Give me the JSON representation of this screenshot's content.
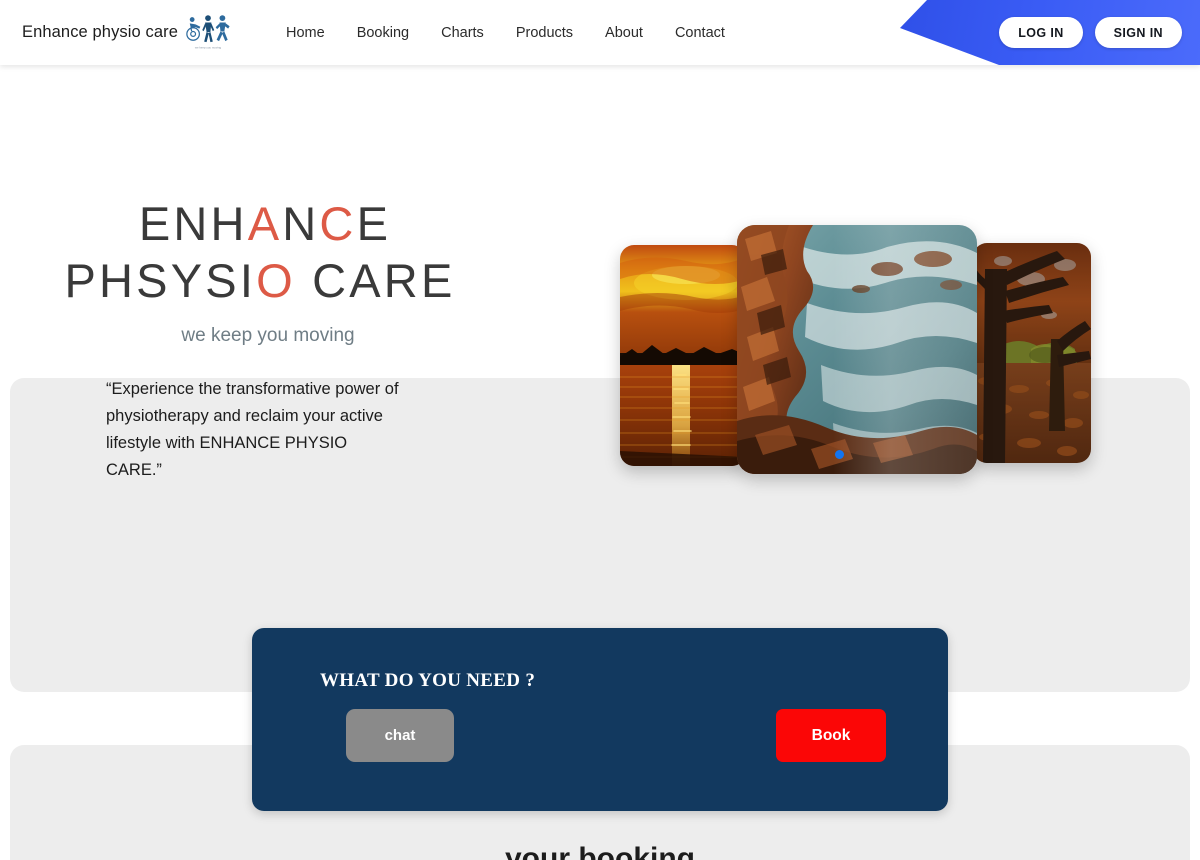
{
  "header": {
    "brand_text": "Enhance physio care",
    "logo_icon": "physio-figures-logo",
    "logo_tagline": "we keep you moving",
    "nav": [
      {
        "label": "Home"
      },
      {
        "label": "Booking"
      },
      {
        "label": "Charts"
      },
      {
        "label": "Products"
      },
      {
        "label": "About"
      },
      {
        "label": "Contact"
      }
    ],
    "login_label": "LOG IN",
    "signin_label": "SIGN IN",
    "banner_color": "#3a5cf5"
  },
  "hero": {
    "title_line1_a": "ENH",
    "title_line1_accent1": "A",
    "title_line1_b": "N",
    "title_line1_accent2": "C",
    "title_line1_c": "E",
    "title_line2_a": "PHSYSI",
    "title_line2_accent": "O",
    "title_line2_b": " CARE",
    "tagline": "we keep you moving",
    "quote": "“Experience the transformative power of physiotherapy and reclaim your active lifestyle with ENHANCE PHYSIO CARE.”",
    "accent_color": "#dd5a46",
    "title_color": "#3a3a3a",
    "tagline_color": "#6f7d85"
  },
  "carousel": {
    "slides": [
      {
        "name": "sunset-over-water",
        "alt": "Orange sunset reflecting over a lake"
      },
      {
        "name": "rocky-coastline",
        "alt": "Red rocky coastline with misty teal sea"
      },
      {
        "name": "autumn-trees",
        "alt": "Autumn trees with fallen orange leaves"
      }
    ],
    "active_index": 1,
    "dot_color": "#1275f3"
  },
  "need_card": {
    "title": "WHAT DO YOU NEED ?",
    "chat_label": "chat",
    "book_label": "Book",
    "card_color": "#12395f",
    "chat_color": "#8a8a8a",
    "book_color": "#fb0606"
  },
  "bottom": {
    "heading": "your booking"
  }
}
